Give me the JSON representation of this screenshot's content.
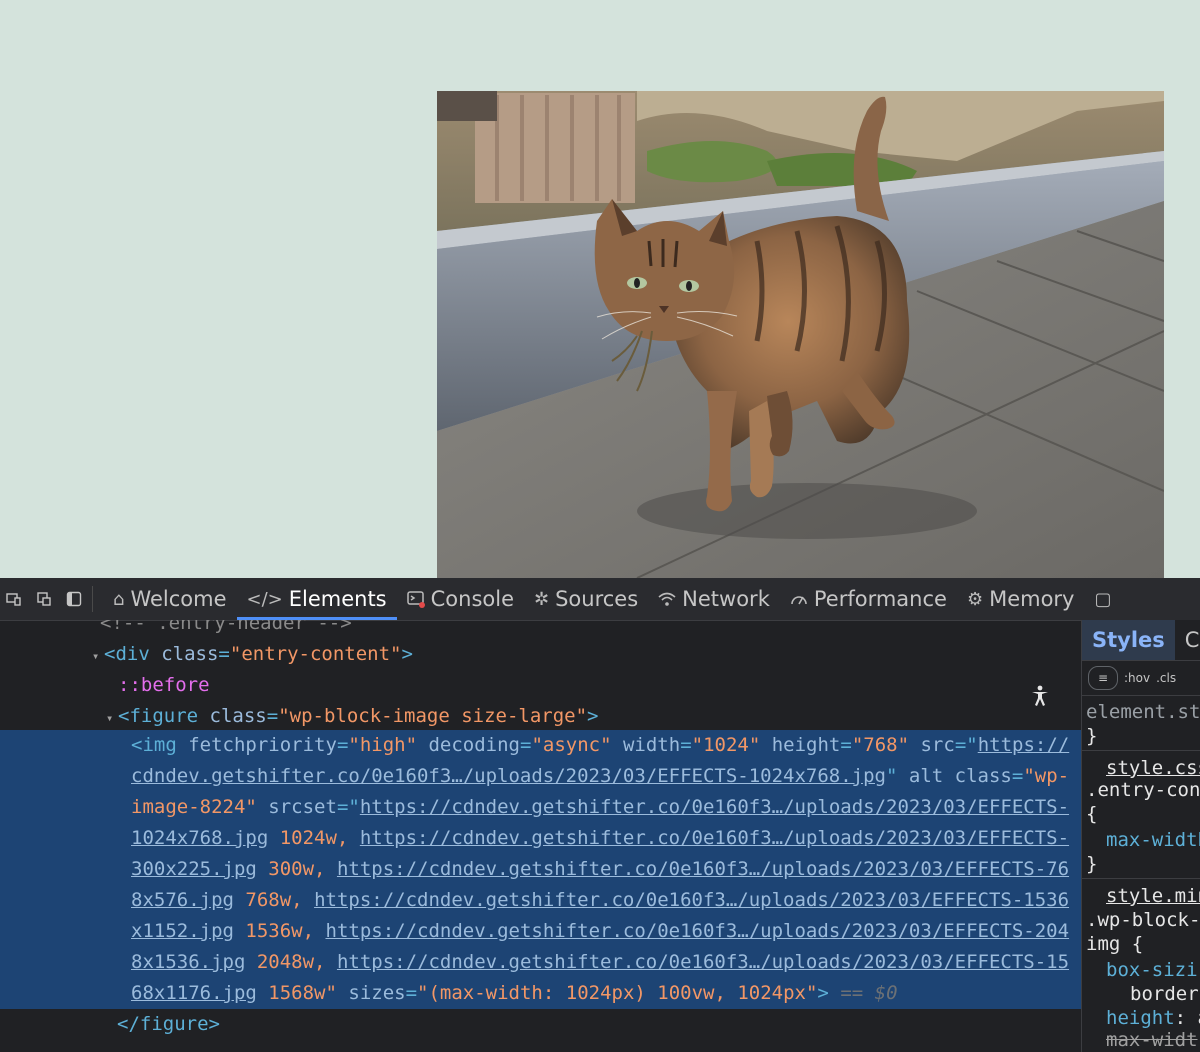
{
  "page": {
    "background": "#d4e3dc"
  },
  "devtools": {
    "toolbar_icons": [
      "device-toggle-icon",
      "dock-icon",
      "sidebar-icon"
    ],
    "tabs": [
      {
        "label": "Welcome",
        "icon": "home-icon"
      },
      {
        "label": "Elements",
        "icon": "code-icon",
        "active": true
      },
      {
        "label": "Console",
        "icon": "console-icon"
      },
      {
        "label": "Sources",
        "icon": "bug-icon"
      },
      {
        "label": "Network",
        "icon": "wifi-icon"
      },
      {
        "label": "Performance",
        "icon": "gauge-icon"
      },
      {
        "label": "Memory",
        "icon": "chip-icon"
      }
    ],
    "elements": {
      "partial_header_text": "<!--  .entry-header  -->",
      "div_tag": "<div",
      "div_attr": "class",
      "div_val": "\"entry-content\"",
      "div_close": ">",
      "before_pseudo": "::before",
      "figure_tag": "<figure",
      "figure_attr": "class",
      "figure_val": "\"wp-block-image size-large\"",
      "figure_close": ">",
      "img_open": "<img",
      "img_attrs": [
        {
          "name": "fetchpriority",
          "value": "\"high\""
        },
        {
          "name": "decoding",
          "value": "\"async\""
        },
        {
          "name": "width",
          "value": "\"1024\""
        },
        {
          "name": "height",
          "value": "\"768\""
        }
      ],
      "img_src_name": "src",
      "img_src": "https://cdndev.getshifter.co/0e160f3…/uploads/2023/03/EFFECTS-1024x768.jpg",
      "img_alt_name": "alt",
      "img_class_name": "class",
      "img_class_val": "\"wp-image-8224\"",
      "img_srcset_name": "srcset",
      "srcset": [
        {
          "url": "https://cdndev.getshifter.co/0e160f3…/uploads/2023/03/EFFECTS-1024x768.jpg",
          "w": "1024w,"
        },
        {
          "url": "https://cdndev.getshifter.co/0e160f3…/uploads/2023/03/EFFECTS-300x225.jpg",
          "w": "300w,"
        },
        {
          "url": "https://cdndev.getshifter.co/0e160f3…/uploads/2023/03/EFFECTS-768x576.jpg",
          "w": "768w,"
        },
        {
          "url": "https://cdndev.getshifter.co/0e160f3…/uploads/2023/03/EFFECTS-1536x1152.jpg",
          "w": "1536w,"
        },
        {
          "url": "https://cdndev.getshifter.co/0e160f3…/uploads/2023/03/EFFECTS-2048x1536.jpg",
          "w": "2048w,"
        },
        {
          "url": "https://cdndev.getshifter.co/0e160f3…/uploads/2023/03/EFFECTS-1568x1176.jpg",
          "w": "1568w\""
        }
      ],
      "img_sizes_name": "sizes",
      "img_sizes_val": "\"(max-width: 1024px) 100vw, 1024px\"",
      "img_close": ">",
      "dollar_zero": "== $0",
      "figure_end": "</figure>"
    },
    "styles": {
      "tabs": [
        "Styles",
        "C"
      ],
      "filter_hov": ":hov",
      "filter_cls": ".cls",
      "element_style": "element.st",
      "close_brace": "}",
      "rule1_source": "style.css",
      "rule1_selector": ".entry-con",
      "open_brace": "{",
      "rule1_prop": "max-width",
      "rule2_source": "style.min",
      "rule2_selector": ".wp-block-",
      "rule2_selector2": "img {",
      "rule2_prop1": "box-sizi",
      "rule2_val1": "border",
      "rule2_prop2": "height",
      "rule2_val2": "a",
      "rule2_prop3": "max-widt"
    }
  }
}
